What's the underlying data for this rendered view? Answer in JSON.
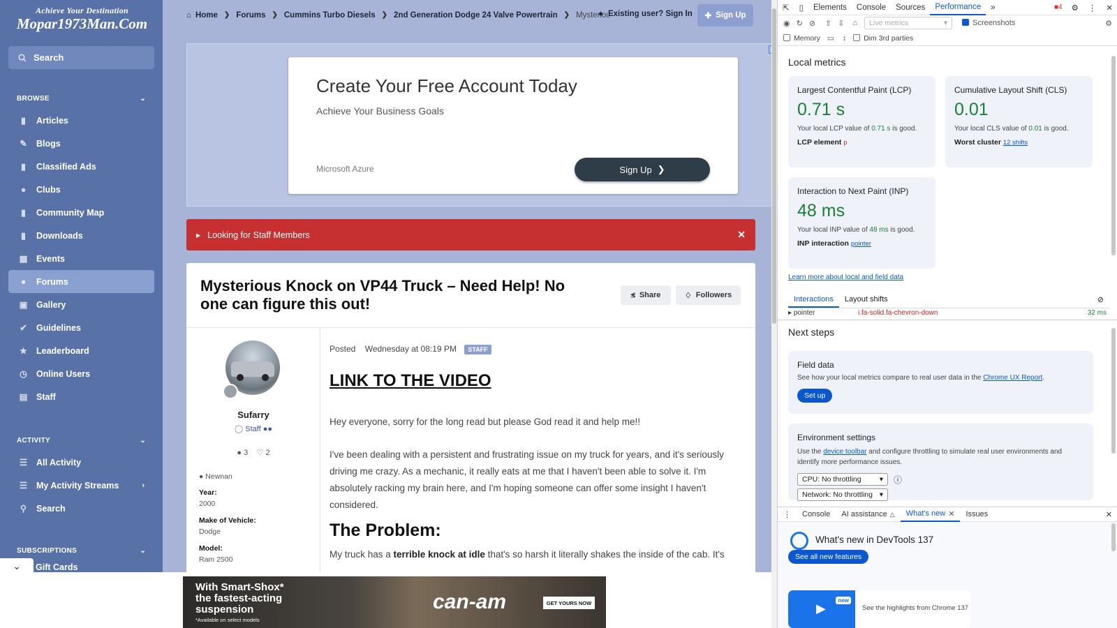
{
  "sidebar": {
    "logo_tagline": "Achieve Your Destination",
    "logo_name": "Mopar1973Man.Com",
    "search_label": "Search",
    "sections": [
      {
        "label": "BROWSE"
      },
      {
        "label": "ACTIVITY"
      },
      {
        "label": "SUBSCRIPTIONS"
      }
    ],
    "browse_items": [
      {
        "label": "Articles",
        "icon": "document-icon"
      },
      {
        "label": "Blogs",
        "icon": "edit-icon"
      },
      {
        "label": "Classified Ads",
        "icon": "document-icon"
      },
      {
        "label": "Clubs",
        "icon": "users-icon"
      },
      {
        "label": "Community Map",
        "icon": "document-icon"
      },
      {
        "label": "Downloads",
        "icon": "document-icon"
      },
      {
        "label": "Events",
        "icon": "calendar-icon"
      },
      {
        "label": "Forums",
        "icon": "comment-icon",
        "active": true
      },
      {
        "label": "Gallery",
        "icon": "image-icon"
      },
      {
        "label": "Guidelines",
        "icon": "check-circle-icon"
      },
      {
        "label": "Leaderboard",
        "icon": "trophy-icon"
      },
      {
        "label": "Online Users",
        "icon": "clock-icon"
      },
      {
        "label": "Staff",
        "icon": "id-card-icon"
      }
    ],
    "activity_items": [
      {
        "label": "All Activity",
        "icon": "list-icon"
      },
      {
        "label": "My Activity Streams",
        "icon": "list-icon"
      },
      {
        "label": "Search",
        "icon": "search-icon"
      }
    ],
    "subscription_items": [
      {
        "label": "Gift Cards"
      }
    ]
  },
  "topbar": {
    "breadcrumb": [
      "Home",
      "Forums",
      "Cummins Turbo Diesels",
      "2nd Generation Dodge 24 Valve Powertrain",
      "Mysteriou"
    ],
    "signin_label": "Existing user? Sign In",
    "signup_label": "Sign Up"
  },
  "ad": {
    "headline": "Create Your Free Account Today",
    "subhead": "Achieve Your Business Goals",
    "brand": "Microsoft Azure",
    "button": "Sign Up"
  },
  "alert": {
    "text": "Looking for Staff Members"
  },
  "post": {
    "title": "Mysterious Knock on VP44 Truck – Need Help! No one can figure this out!",
    "share_label": "Share",
    "followers_label": "Followers",
    "author": {
      "name": "Sufarry",
      "role": "Staff",
      "comments": "3",
      "likes": "2",
      "location": "Newnan",
      "fields": [
        {
          "label": "Year:",
          "value": "2000"
        },
        {
          "label": "Make of Vehicle:",
          "value": "Dodge"
        },
        {
          "label": "Model:",
          "value": "Ram 2500"
        }
      ]
    },
    "posted_label": "Posted",
    "posted_date": "Wednesday at 08:19 PM",
    "staff_badge": "STAFF",
    "video_link": "LINK TO THE VIDEO",
    "para1": "Hey everyone, sorry for the long read but please God read it and help me!!",
    "para2": "I've been dealing with a persistent and frustrating issue on my truck for years, and it's seriously driving me crazy. As a mechanic, it really eats at me that I haven't been able to solve it. I'm absolutely racking my brain here, and I'm hoping someone can offer some insight I haven't considered.",
    "heading": "The Problem:",
    "para3_prefix": "My truck has a ",
    "para3_bold": "terrible knock at idle",
    "para3_suffix": " that's so harsh it literally shakes the inside of the cab. It's"
  },
  "bottom_ad": {
    "line1": "With Smart-Shox*",
    "line2": "the fastest-acting",
    "line3": "suspension",
    "note": "*Available on select models",
    "brand": "can-am",
    "cta": "GET YOURS NOW"
  },
  "devtools": {
    "tabs": [
      "Elements",
      "Console",
      "Sources",
      "Performance"
    ],
    "active_tab": "Performance",
    "issues_count": "4",
    "live_metrics": "Live metrics",
    "screenshots_label": "Screenshots",
    "memory_label": "Memory",
    "dim_label": "Dim 3rd parties",
    "local_metrics_title": "Local metrics",
    "lcp": {
      "title": "Largest Contentful Paint (LCP)",
      "value": "0.71 s",
      "desc_prefix": "Your local LCP value of ",
      "desc_value": "0.71 s",
      "desc_suffix": " is good.",
      "element_label": "LCP element",
      "element_value": "p"
    },
    "cls": {
      "title": "Cumulative Layout Shift (CLS)",
      "value": "0.01",
      "desc_prefix": "Your local CLS value of ",
      "desc_value": "0.01",
      "desc_suffix": " is good.",
      "cluster_label": "Worst cluster",
      "cluster_value": "12 shifts"
    },
    "inp": {
      "title": "Interaction to Next Paint (INP)",
      "value": "48 ms",
      "desc_prefix": "Your local INP value of ",
      "desc_value": "48 ms",
      "desc_suffix": " is good.",
      "interaction_label": "INP interaction",
      "interaction_value": "pointer"
    },
    "learn_more": "Learn more about local and field data",
    "subtabs": [
      "Interactions",
      "Layout shifts"
    ],
    "interaction_row": {
      "type": "pointer",
      "target": "i.fa-solid.fa-chevron-down",
      "time": "32 ms"
    },
    "next_steps_title": "Next steps",
    "field_data": {
      "title": "Field data",
      "desc_prefix": "See how your local metrics compare to real user data in the ",
      "desc_link": "Chrome UX Report",
      "desc_suffix": ".",
      "button": "Set up"
    },
    "env": {
      "title": "Environment settings",
      "desc_prefix": "Use the ",
      "desc_link": "device toolbar",
      "desc_suffix": " and configure throttling to simulate real user environments and identify more performance issues.",
      "cpu": "CPU: No throttling",
      "network": "Network: No throttling"
    },
    "drawer_tabs": [
      "Console",
      "AI assistance",
      "What's new",
      "Issues"
    ],
    "whats_new_title": "What's new in DevTools 137",
    "whats_new_button": "See all new features",
    "highlight_badge": "new",
    "highlight_text": "See the highlights from Chrome 137"
  }
}
